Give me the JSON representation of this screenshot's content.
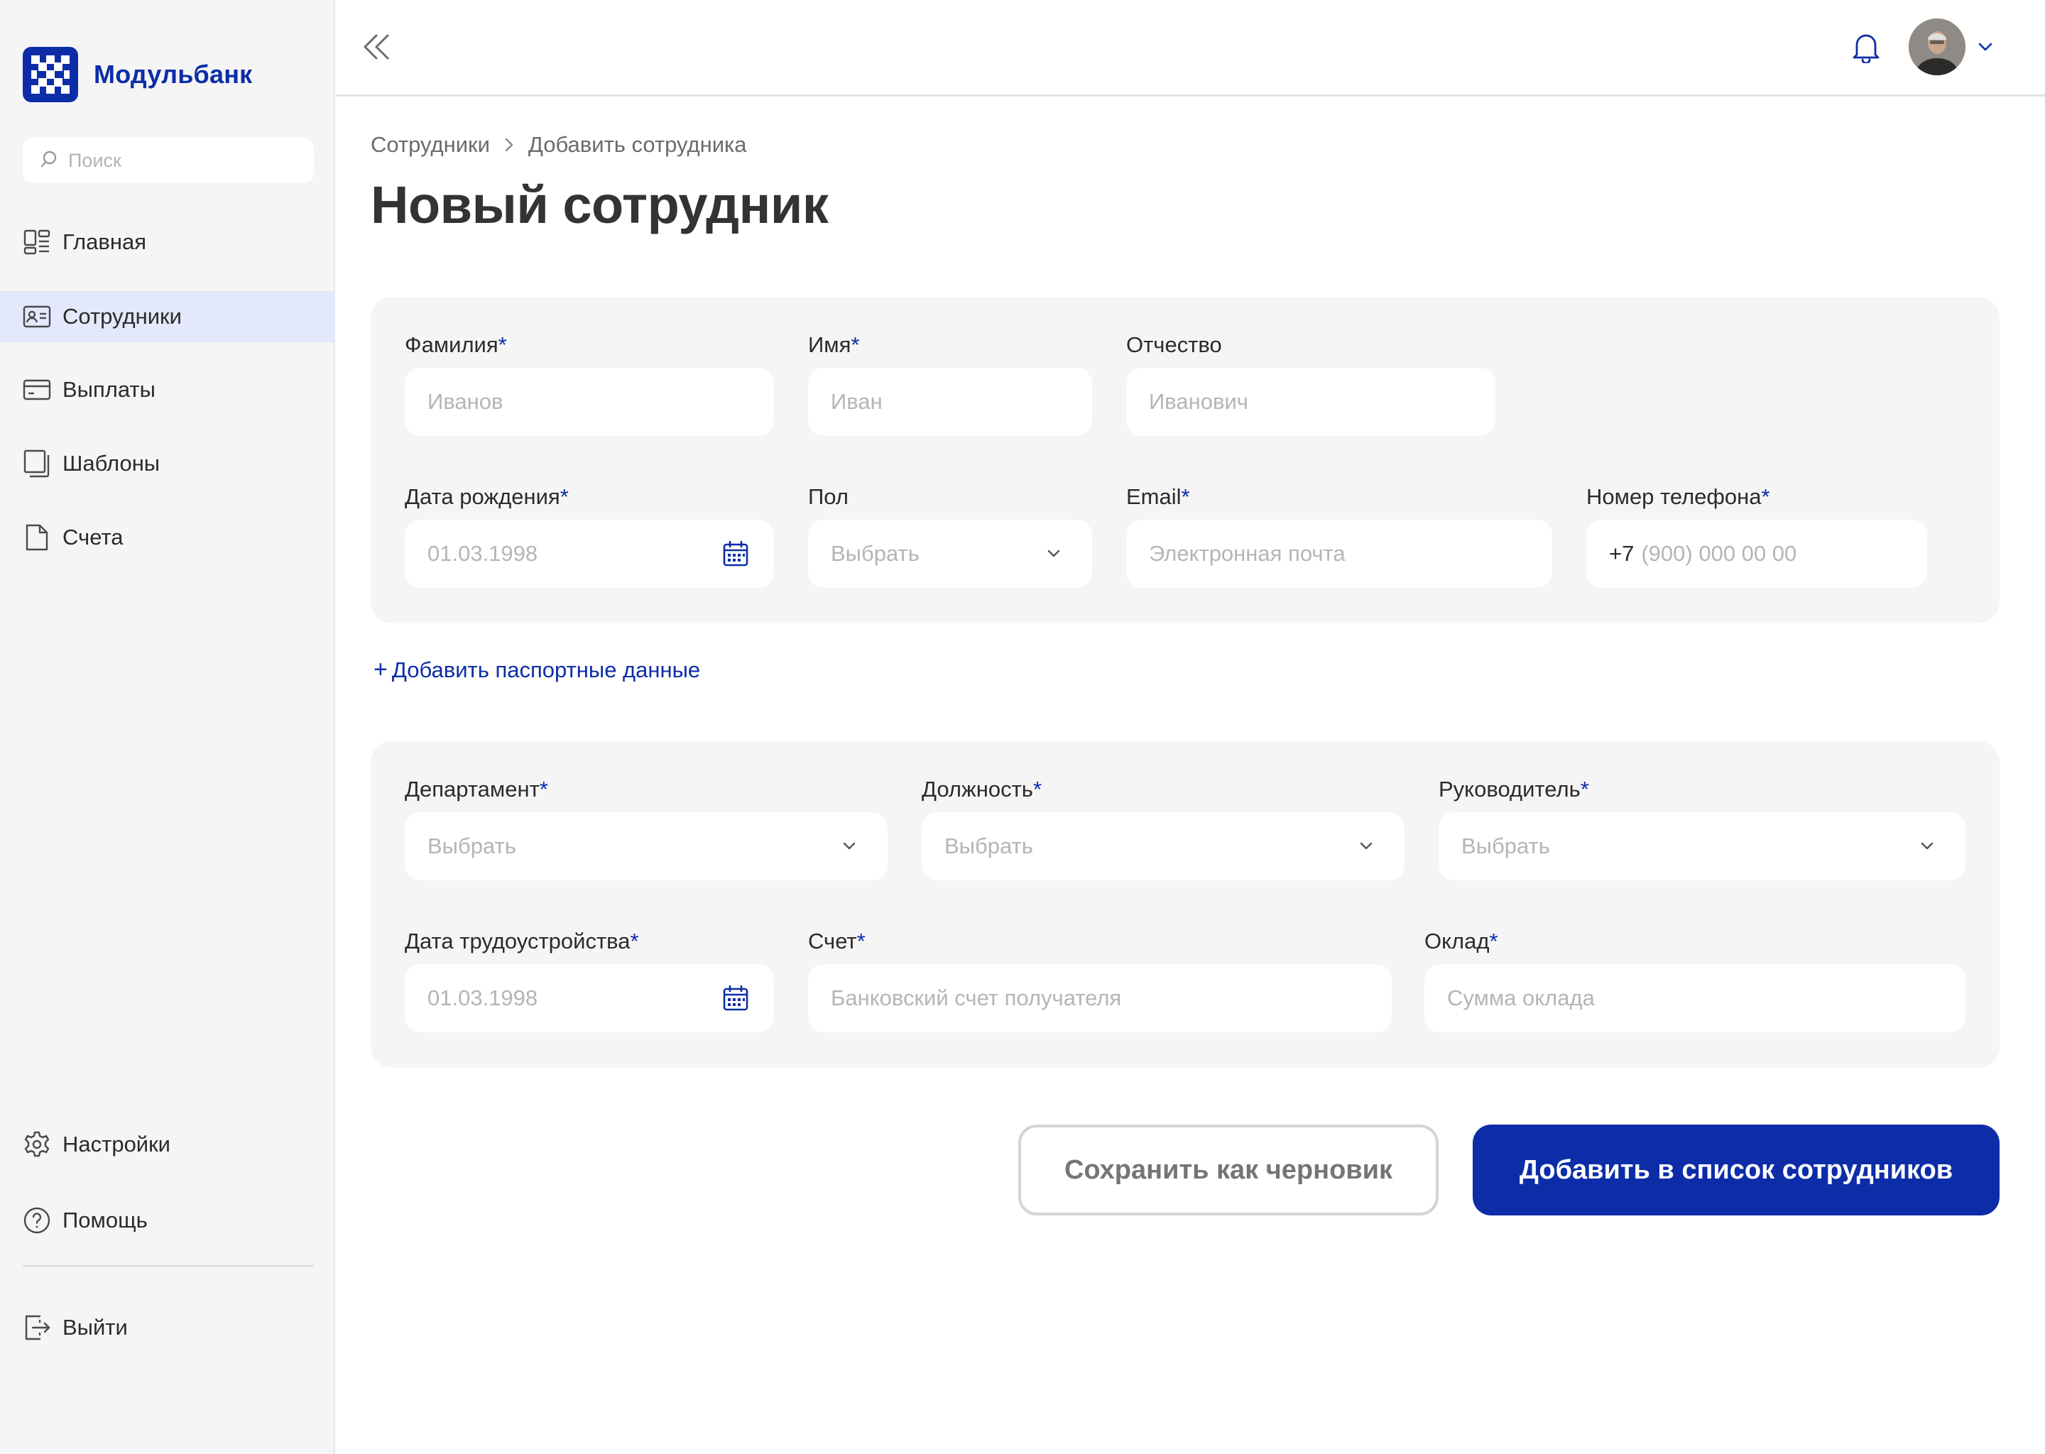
{
  "brand": {
    "name": "Модульбанк",
    "color": "#0d2da8"
  },
  "sidebar": {
    "search_placeholder": "Поиск",
    "items": [
      {
        "label": "Главная",
        "icon": "dashboard-icon",
        "active": false
      },
      {
        "label": "Сотрудники",
        "icon": "id-card-icon",
        "active": true
      },
      {
        "label": "Выплаты",
        "icon": "credit-card-icon",
        "active": false
      },
      {
        "label": "Шаблоны",
        "icon": "copy-icon",
        "active": false
      },
      {
        "label": "Счета",
        "icon": "file-icon",
        "active": false
      }
    ],
    "bottom_items": [
      {
        "label": "Настройки",
        "icon": "gear-icon"
      },
      {
        "label": "Помощь",
        "icon": "help-icon"
      },
      {
        "label": "Выйти",
        "icon": "logout-icon"
      }
    ]
  },
  "breadcrumb": {
    "parent": "Сотрудники",
    "current": "Добавить сотрудника"
  },
  "page_title": "Новый сотрудник",
  "personal": {
    "last_name": {
      "label": "Фамилия",
      "required": "*",
      "placeholder": "Иванов"
    },
    "first_name": {
      "label": "Имя",
      "required": "*",
      "placeholder": "Иван"
    },
    "patronymic": {
      "label": "Отчество",
      "placeholder": "Иванович"
    },
    "birth_date": {
      "label": "Дата рождения",
      "required": "*",
      "placeholder": "01.03.1998"
    },
    "gender": {
      "label": "Пол",
      "placeholder": "Выбрать"
    },
    "email": {
      "label": "Email",
      "required": "*",
      "placeholder": "Электронная почта"
    },
    "phone": {
      "label": "Номер телефона",
      "required": "*",
      "prefix": "+7",
      "placeholder": "(900) 000 00 00"
    }
  },
  "add_passport_label": "Добавить паспортные данные",
  "add_passport_plus": "+",
  "employment": {
    "department": {
      "label": "Департамент",
      "required": "*",
      "placeholder": "Выбрать"
    },
    "position": {
      "label": "Должность",
      "required": "*",
      "placeholder": "Выбрать"
    },
    "manager": {
      "label": "Руководитель",
      "required": "*",
      "placeholder": "Выбрать"
    },
    "hire_date": {
      "label": "Дата трудоустройства",
      "required": "*",
      "placeholder": "01.03.1998"
    },
    "account": {
      "label": "Счет",
      "required": "*",
      "placeholder": "Банковский счет получателя"
    },
    "salary": {
      "label": "Оклад",
      "required": "*",
      "placeholder": "Сумма оклада"
    }
  },
  "actions": {
    "draft_label": "Сохранить как черновик",
    "submit_label": "Добавить в список сотрудников"
  }
}
